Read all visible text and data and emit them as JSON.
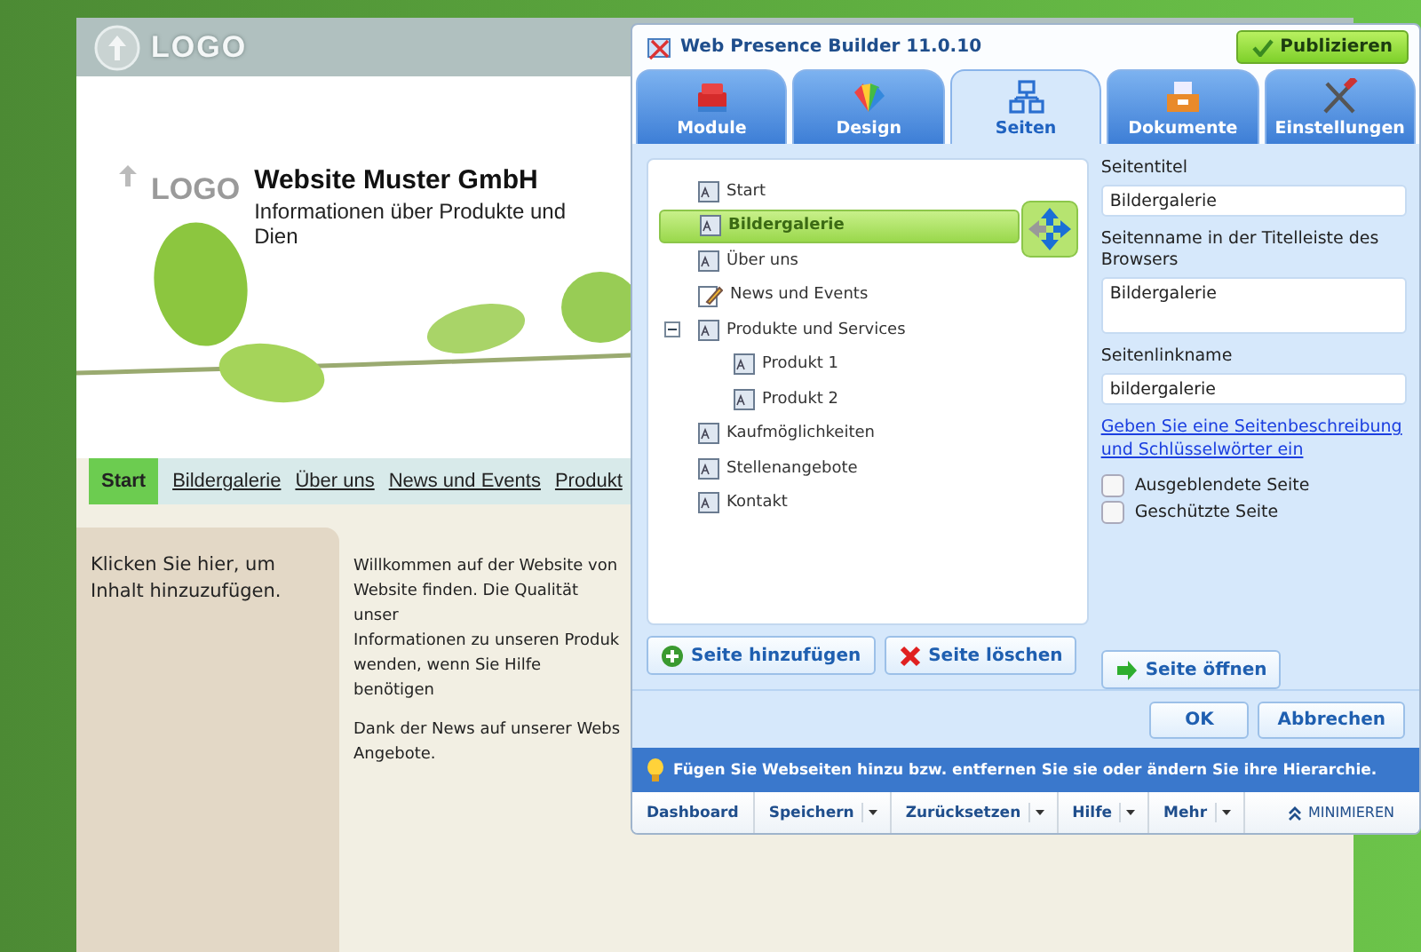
{
  "site": {
    "top_logo": "LOGO",
    "header_logo": "LOGO",
    "title": "Website Muster GmbH",
    "subtitle": "Informationen über Produkte und Dien",
    "nav": [
      {
        "label": "Start",
        "selected": true
      },
      {
        "label": "Bildergalerie",
        "selected": false
      },
      {
        "label": "Über uns",
        "selected": false
      },
      {
        "label": "News und Events",
        "selected": false
      },
      {
        "label": "Produkt",
        "selected": false
      }
    ],
    "sidebar_text": "Klicken Sie hier, um Inhalt hinzuzufügen.",
    "paragraphs": [
      [
        "Willkommen auf der Website von",
        "Website finden. Die Qualität unser",
        "Informationen zu unseren Produk",
        "wenden, wenn Sie Hilfe benötigen"
      ],
      [
        "Dank der News auf unserer Webs",
        "Angebote."
      ]
    ]
  },
  "window": {
    "title": "Web Presence Builder 11.0.10",
    "publish_button": "Publizieren"
  },
  "tabs": [
    {
      "label": "Module",
      "kind": "modules",
      "selected": false
    },
    {
      "label": "Design",
      "kind": "design",
      "selected": false
    },
    {
      "label": "Seiten",
      "kind": "pages",
      "selected": true
    },
    {
      "label": "Dokumente",
      "kind": "documents",
      "selected": false
    },
    {
      "label": "Einstellungen",
      "kind": "settings",
      "selected": false
    }
  ],
  "page_tree": [
    {
      "label": "Start",
      "kind": "page",
      "selected": false
    },
    {
      "label": "Bildergalerie",
      "kind": "page",
      "selected": true
    },
    {
      "label": "Über uns",
      "kind": "page",
      "selected": false
    },
    {
      "label": "News und Events",
      "kind": "editor",
      "selected": false
    },
    {
      "label": "Produkte und Services",
      "kind": "page",
      "selected": false,
      "expanded": true,
      "children": [
        {
          "label": "Produkt 1",
          "kind": "page",
          "selected": false
        },
        {
          "label": "Produkt 2",
          "kind": "page",
          "selected": false
        }
      ]
    },
    {
      "label": "Kaufmöglichkeiten",
      "kind": "page",
      "selected": false
    },
    {
      "label": "Stellenangebote",
      "kind": "page",
      "selected": false
    },
    {
      "label": "Kontakt",
      "kind": "page",
      "selected": false
    }
  ],
  "tree_buttons": [
    {
      "label": "Seite hinzufügen",
      "kind": "add"
    },
    {
      "label": "Seite löschen",
      "kind": "delete"
    }
  ],
  "properties": {
    "fields": [
      {
        "label": "Seitentitel",
        "value": "Bildergalerie",
        "kind": "input"
      },
      {
        "label": "Seitenname in der Titelleiste des Browsers",
        "value": "Bildergalerie",
        "kind": "textarea"
      },
      {
        "label": "Seitenlinkname",
        "value": "bildergalerie",
        "kind": "input"
      }
    ],
    "link": "Geben Sie eine Seitenbeschreibung und Schlüsselwörter ein",
    "checkboxes": [
      {
        "label": "Ausgeblendete Seite",
        "checked": false
      },
      {
        "label": "Geschützte Seite",
        "checked": false
      }
    ],
    "open_button": {
      "label": "Seite öffnen",
      "kind": "open"
    }
  },
  "dialog_buttons": [
    "OK",
    "Abbrechen"
  ],
  "hint": "Fügen Sie Webseiten hinzu bzw. entfernen Sie sie oder ändern Sie ihre Hierarchie.",
  "toolbar": [
    {
      "label": "Dashboard",
      "dropdown": false
    },
    {
      "label": "Speichern",
      "dropdown": true
    },
    {
      "label": "Zurücksetzen",
      "dropdown": true
    },
    {
      "label": "Hilfe",
      "dropdown": true
    },
    {
      "label": "Mehr",
      "dropdown": true
    }
  ],
  "minimize": "MINIMIEREN"
}
